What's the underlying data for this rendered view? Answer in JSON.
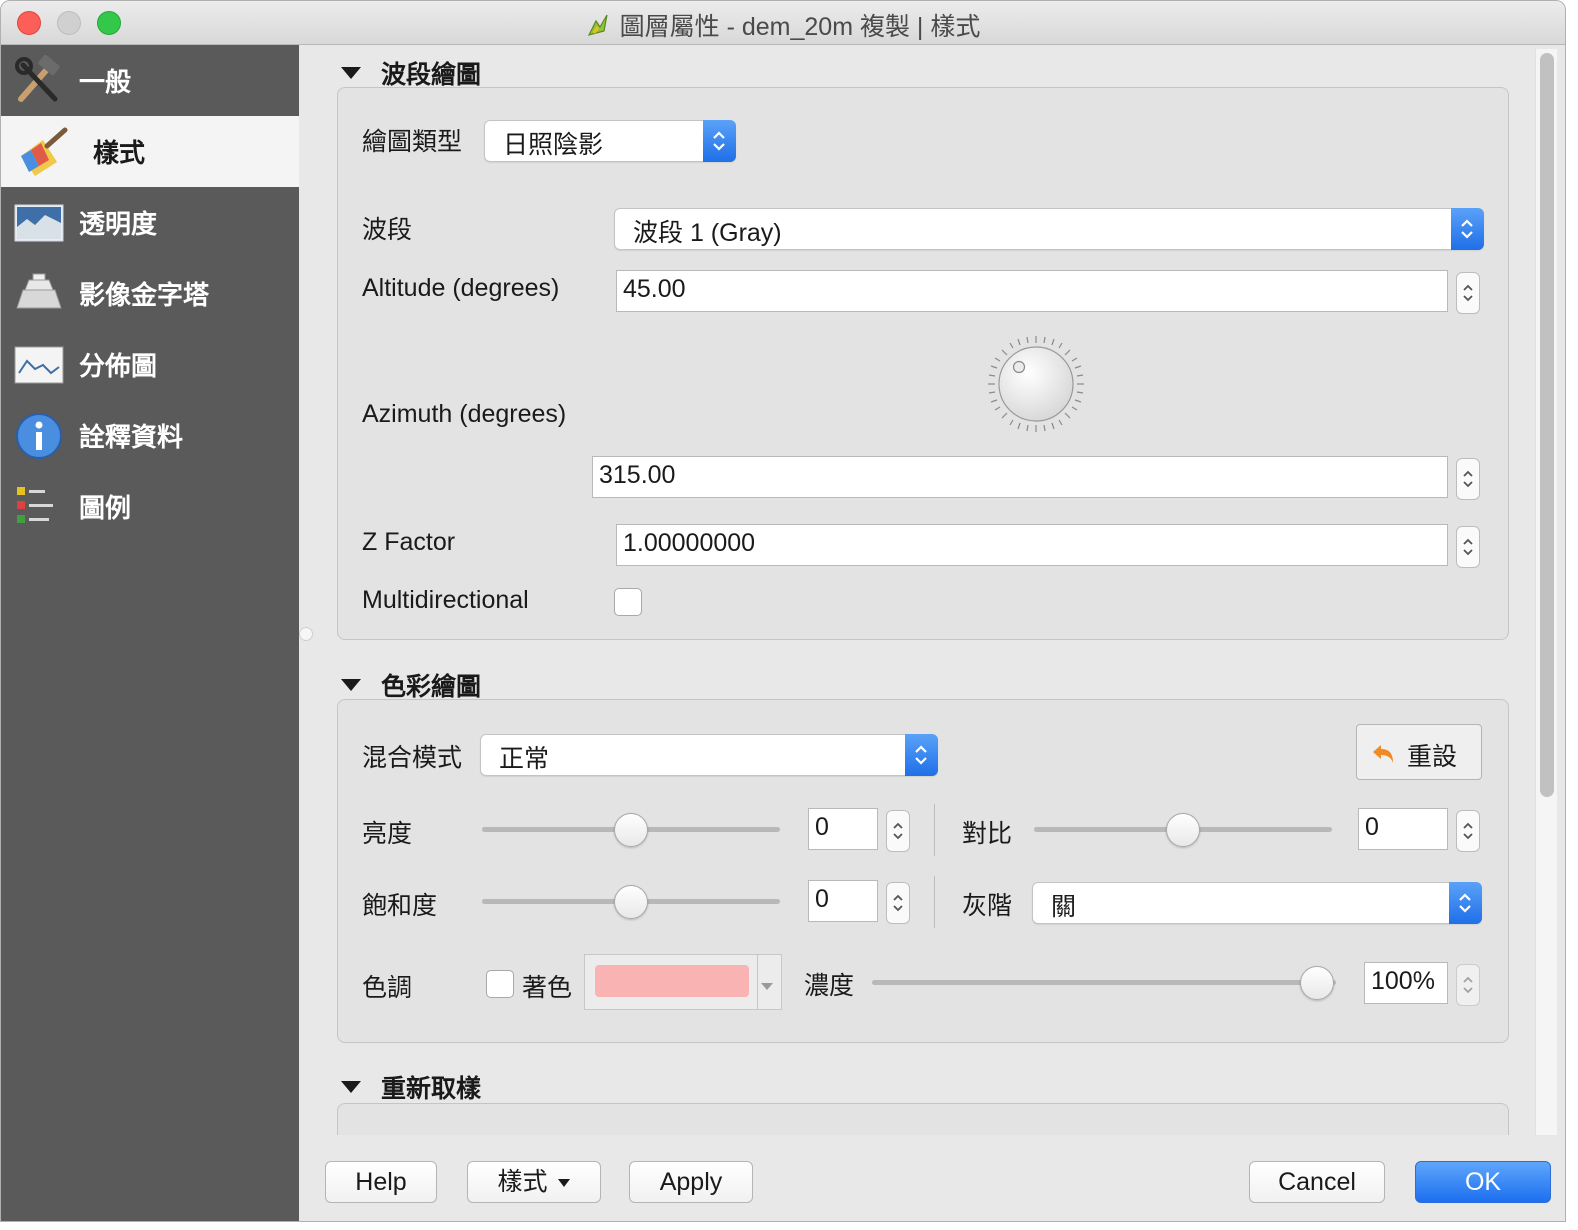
{
  "window": {
    "title": "圖層屬性 - dem_20m 複製 | 樣式"
  },
  "sidebar": {
    "items": [
      {
        "label": "一般",
        "icon": "hammer-wrench-icon"
      },
      {
        "label": "樣式",
        "icon": "paintbrush-icon",
        "active": true
      },
      {
        "label": "透明度",
        "icon": "transparency-icon"
      },
      {
        "label": "影像金字塔",
        "icon": "pyramid-icon"
      },
      {
        "label": "分佈圖",
        "icon": "histogram-icon"
      },
      {
        "label": "詮釋資料",
        "icon": "info-icon"
      },
      {
        "label": "圖例",
        "icon": "legend-icon"
      }
    ]
  },
  "band_rendering": {
    "header": "波段繪圖",
    "render_type_label": "繪圖類型",
    "render_type_value": "日照陰影",
    "band_label": "波段",
    "band_value": "波段 1 (Gray)",
    "altitude_label": "Altitude (degrees)",
    "altitude_value": "45.00",
    "azimuth_label": "Azimuth (degrees)",
    "azimuth_value": "315.00",
    "zfactor_label": "Z Factor",
    "zfactor_value": "1.00000000",
    "multidirectional_label": "Multidirectional",
    "multidirectional_checked": false
  },
  "color_rendering": {
    "header": "色彩繪圖",
    "blend_label": "混合模式",
    "blend_value": "正常",
    "reset_label": "重設",
    "brightness_label": "亮度",
    "brightness_value": "0",
    "contrast_label": "對比",
    "contrast_value": "0",
    "saturation_label": "飽和度",
    "saturation_value": "0",
    "grayscale_label": "灰階",
    "grayscale_value": "關",
    "hue_label": "色調",
    "colorize_label": "著色",
    "colorize_checked": false,
    "colorize_color": "#f9b3b3",
    "strength_label": "濃度",
    "strength_value": "100%"
  },
  "resampling": {
    "header": "重新取樣"
  },
  "footer": {
    "help": "Help",
    "style": "樣式",
    "apply": "Apply",
    "cancel": "Cancel",
    "ok": "OK"
  },
  "colors": {
    "accent": "#1f6fe8",
    "sidebar_bg": "#5a5a5a",
    "reset_arrow": "#f08a24"
  }
}
